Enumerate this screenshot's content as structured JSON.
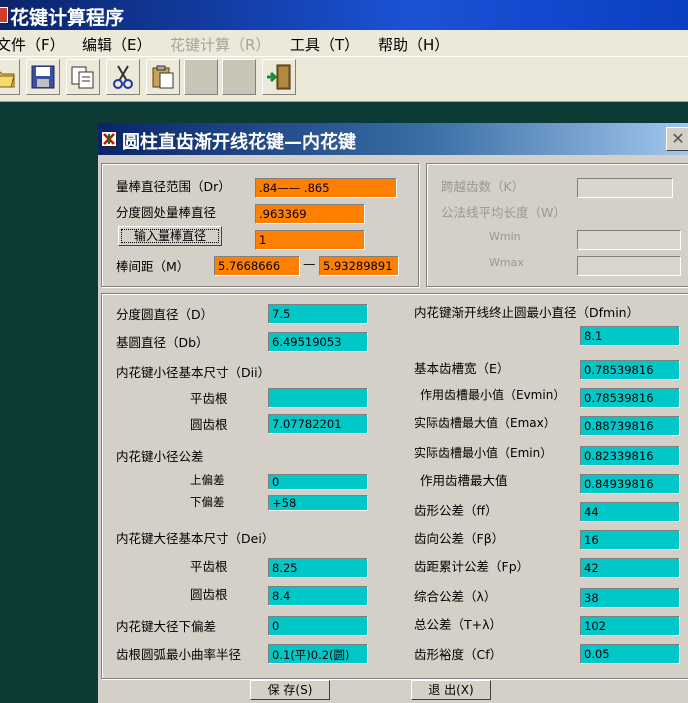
{
  "app": {
    "title": "花键计算程序"
  },
  "menu": [
    {
      "label": "文件（F）",
      "enabled": true
    },
    {
      "label": "编辑（E）",
      "enabled": true
    },
    {
      "label": "花键计算（R）",
      "enabled": false
    },
    {
      "label": "工具（T）",
      "enabled": true
    },
    {
      "label": "帮助（H）",
      "enabled": true
    }
  ],
  "toolbar": {
    "icons": [
      "open-folder-icon",
      "save-icon",
      "copy-icon",
      "cut-icon",
      "paste-icon",
      "blank-icon",
      "blank-icon",
      "exit-door-icon"
    ]
  },
  "dialog": {
    "title": "圆柱直齿渐开线花键—内花键",
    "top_left": {
      "rod_diameter_range_label": "量棒直径范围（Dr）",
      "rod_diameter_range_value": ".84——  .865",
      "pitch_rod_diameter_label": "分度圆处量棒直径",
      "pitch_rod_diameter_value": ".963369",
      "input_rod_button": "输入量棒直径",
      "input_rod_value": "1",
      "rod_spacing_label": "棒间距（M）",
      "rod_spacing_min": "5.7668666",
      "rod_spacing_dash": "—",
      "rod_spacing_max": "5.93289891"
    },
    "top_right": {
      "span_teeth_label": "跨越齿数（K）",
      "span_teeth_value": "",
      "normal_length_label": "公法线平均长度（W）",
      "wmin_label": "Wmin",
      "wmin_value": "",
      "wmax_label": "Wmax",
      "wmax_value": ""
    },
    "left": {
      "pitch_dia_label": "分度圆直径（D）",
      "pitch_dia_value": "7.5",
      "base_dia_label": "基圆直径（Db）",
      "base_dia_value": "6.49519053",
      "minor_basic_label": "内花键小径基本尺寸（Dii）",
      "flat_root_label": "平齿根",
      "flat_root_value": "",
      "round_root_label": "圆齿根",
      "round_root_value": "7.07782201",
      "minor_tol_label": "内花键小径公差",
      "upper_dev_label": "上偏差",
      "upper_dev_value": "0",
      "lower_dev_label": "下偏差",
      "lower_dev_value": "+58",
      "major_basic_label": "内花键大径基本尺寸（Dei）",
      "major_flat_label": "平齿根",
      "major_flat_value": "8.25",
      "major_round_label": "圆齿根",
      "major_round_value": "8.4",
      "major_lower_dev_label": "内花键大径下偏差",
      "major_lower_dev_value": "0",
      "fillet_radius_label": "齿根圆弧最小曲率半径",
      "fillet_radius_value": "0.1(平)0.2(圆)"
    },
    "right": {
      "involute_end_label": "内花键渐开线终止圆最小直径（Dfmin）",
      "involute_end_value": "8.1",
      "basic_space_label": "基本齿槽宽（E）",
      "basic_space_value": "0.78539816",
      "eff_space_min_label": "作用齿槽最小值（Evmin）",
      "eff_space_min_value": "0.78539816",
      "act_space_max_label": "实际齿槽最大值（Emax）",
      "act_space_max_value": "0.88739816",
      "act_space_min_label": "实际齿槽最小值（Emin）",
      "act_space_min_value": "0.82339816",
      "eff_space_max_label": "作用齿槽最大值",
      "eff_space_max_value": "0.84939816",
      "profile_tol_label": "齿形公差（ff）",
      "profile_tol_value": "44",
      "lead_tol_label": "齿向公差（Fβ）",
      "lead_tol_value": "16",
      "pitch_cum_tol_label": "齿距累计公差（Fp）",
      "pitch_cum_tol_value": "42",
      "comp_tol_label": "综合公差（λ）",
      "comp_tol_value": "38",
      "total_tol_label": "总公差（T+λ）",
      "total_tol_value": "102",
      "profile_margin_label": "齿形裕度（Cf）",
      "profile_margin_value": "0.05"
    },
    "buttons": {
      "save": "保 存(S)",
      "exit": "退 出(X)"
    }
  },
  "colors": {
    "accent_orange": "#ff8000",
    "accent_teal": "#00c8c8",
    "desktop": "#0c3b36",
    "titlebar": "#0a246a"
  }
}
